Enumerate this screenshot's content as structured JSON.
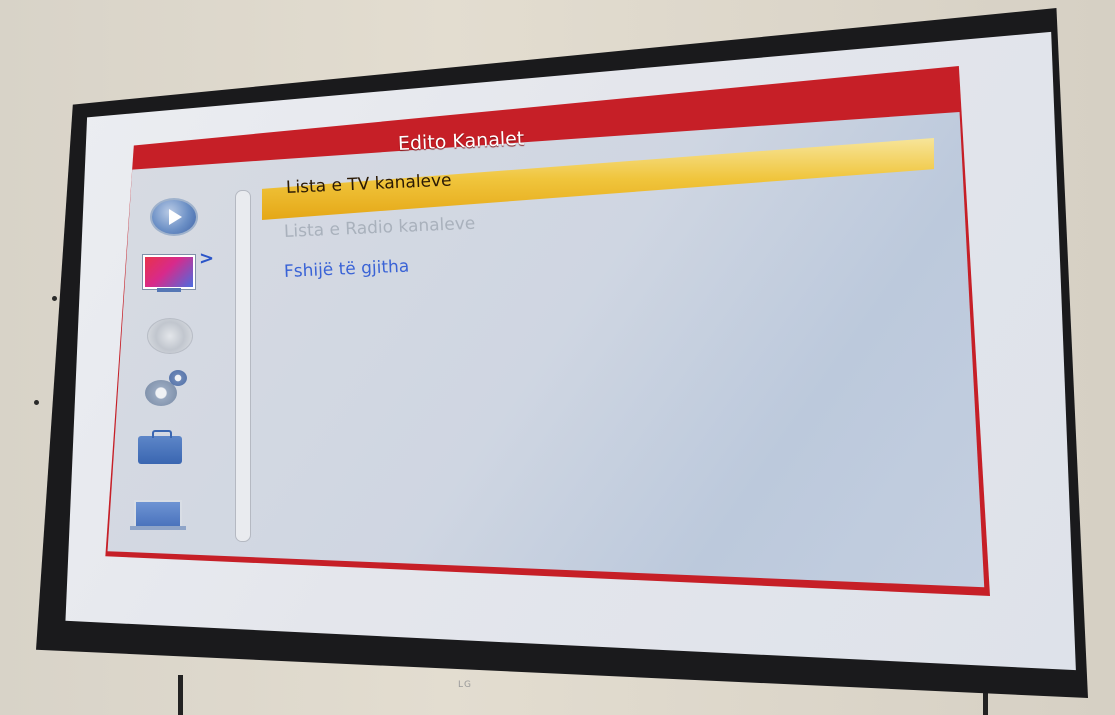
{
  "menu": {
    "title": "Edito Kanalet",
    "items": [
      {
        "label": "Lista e TV kanaleve",
        "state": "selected"
      },
      {
        "label": "Lista e Radio kanaleve",
        "state": "disabled"
      },
      {
        "label": "Fshijë të gjitha",
        "state": "normal"
      }
    ]
  },
  "sidebar": {
    "icons": [
      "play-icon",
      "tv-icon",
      "disc-icon",
      "gear-icon",
      "briefcase-icon",
      "laptop-icon"
    ],
    "active_index": 1,
    "active_arrow": ">"
  },
  "tv": {
    "brand": "LG"
  },
  "colors": {
    "frame_red": "#c61f27",
    "highlight_yellow": "#f0c53c",
    "link_blue": "#3a63d6",
    "disabled_gray": "#a9b1bc"
  }
}
